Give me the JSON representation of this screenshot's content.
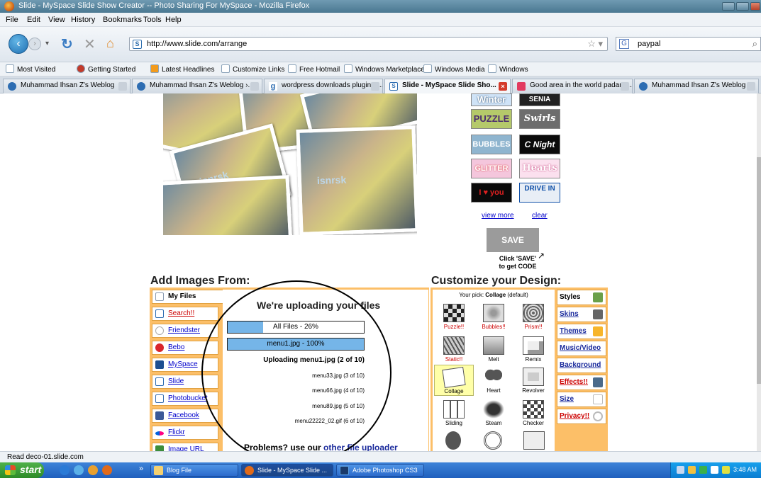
{
  "window": {
    "title": "Slide - MySpace Slide Show Creator -- Photo Sharing For MySpace - Mozilla Firefox"
  },
  "menu": [
    "File",
    "Edit",
    "View",
    "History",
    "Bookmarks",
    "Tools",
    "Help"
  ],
  "nav": {
    "url": "http://www.slide.com/arrange",
    "search_value": "paypal"
  },
  "bookmarks": [
    "Most Visited",
    "Getting Started",
    "Latest Headlines",
    "Customize Links",
    "Free Hotmail",
    "Windows Marketplace",
    "Windows Media",
    "Windows"
  ],
  "tabs": [
    {
      "label": "Muhammad Ihsan Z's Weblog",
      "active": false
    },
    {
      "label": "Muhammad Ihsan Z's Weblog ›...",
      "active": false
    },
    {
      "label": "wordpress downloads plugin - ...",
      "active": false
    },
    {
      "label": "Slide - MySpace Slide Sho...",
      "active": true
    },
    {
      "label": "Good area in the world padang...",
      "active": false
    },
    {
      "label": "Muhammad Ihsan Z's Weblog ›...",
      "active": false
    }
  ],
  "collage": {
    "watermark": "isnrsk"
  },
  "themes": [
    [
      "Winter",
      "SENIA"
    ],
    [
      "PUZZLE",
      "Swirls"
    ],
    [
      "BUBBLES",
      "C Night"
    ],
    [
      "GLITTER",
      "Hearts"
    ],
    [
      "I ♥ you",
      "DRIVE IN"
    ]
  ],
  "theme_links": {
    "view_more": "view more",
    "clear": "clear"
  },
  "save": {
    "label": "SAVE",
    "hint_line1": "Click 'SAVE'",
    "hint_line2": "to get CODE"
  },
  "add_images": {
    "heading": "Add Images From:",
    "sources": [
      "My Files",
      "Search!!",
      "Friendster",
      "Bebo",
      "MySpace",
      "Slide",
      "Photobucket",
      "Facebook",
      "Flickr",
      "Image URL"
    ],
    "upload_title": "We're uploading your files",
    "all_files": "All Files - 26%",
    "all_files_progress": 0.26,
    "current_file": "menu1.jpg - 100%",
    "current_file_progress": 1.0,
    "uploading_status": "Uploading menu1.jpg (2 of 10)",
    "queue": [
      "menu33.jpg (3 of 10)",
      "menu66.jpg (4 of 10)",
      "menu89.jpg (5 of 10)",
      "menu22222_02.gif (6 of 10)"
    ],
    "problems_text": "Problems? use our",
    "problems_link": "other file uploader"
  },
  "customize": {
    "heading": "Customize your Design:",
    "your_pick_label": "Your pick:",
    "your_pick_value": "Collage",
    "your_pick_suffix": "(default)",
    "effects": [
      [
        "Puzzle!!",
        "Bubbles!!",
        "Prism!!"
      ],
      [
        "Static!!",
        "Melt",
        "Remix"
      ],
      [
        "Collage",
        "Heart",
        "Revolver"
      ],
      [
        "Sliding",
        "Steam",
        "Checker"
      ]
    ],
    "styles": [
      "Styles",
      "Skins",
      "Themes",
      "Music/Video",
      "Background",
      "Effects!!",
      "Size",
      "Privacy!!"
    ]
  },
  "status": "Read deco-01.slide.com",
  "taskbar": {
    "start": "start",
    "tasks": [
      "Blog File",
      "Slide - MySpace Slide ...",
      "Adobe Photoshop CS3"
    ],
    "clock": "3:48 AM"
  }
}
